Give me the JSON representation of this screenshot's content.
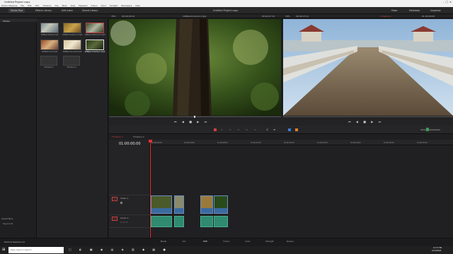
{
  "window": {
    "title": "Untitled Project copy"
  },
  "menu": [
    "DaVinci Resolve",
    "File",
    "Edit",
    "Trim",
    "Timeline",
    "Clip",
    "Mark",
    "View",
    "Playback",
    "Fusion",
    "Color",
    "Fairlight",
    "Workspace",
    "Help"
  ],
  "toolbar": {
    "media_pool": "Media Pool",
    "effects": "Effects Library",
    "edit_index": "Edit Index",
    "sound_library": "Sound Library",
    "project_title": "Untitled Project copy",
    "mixer": "Mixer",
    "metadata": "Metadata",
    "inspector": "Inspector"
  },
  "viewer_bar": {
    "zoom": "76%",
    "src_tc": "00:00:00:12",
    "clip_name": "1080p11medium.mp4",
    "dur": "00:02:27:13",
    "tl_zoom": "76%",
    "tl_tc": "00:00:15:11",
    "timeline_name": "Timeline 1",
    "tl_pos": "01:00:00:00"
  },
  "bins": {
    "master": "Master",
    "smart_bins": "Smart Bins",
    "keywords": "Keywords"
  },
  "media": [
    {
      "label": "1080p11trees.mp4"
    },
    {
      "label": "1080p11autumn.mp4"
    },
    {
      "label": "1080p11kitchen3.mp4"
    },
    {
      "label": "1080p11red.mp4"
    },
    {
      "label": "1080p11sunset.mp4"
    },
    {
      "label": "1080p11medium.mp4"
    },
    {
      "label": "Timeline 1"
    },
    {
      "label": "Timeline 2"
    }
  ],
  "timeline": {
    "tabs": [
      "Timeline 1",
      "Timeline 2"
    ],
    "timecode": "01:00:00:00",
    "ruler": [
      "01:00:00:00",
      "01:00:04:00",
      "01:00:08:00",
      "01:00:12:00",
      "01:00:16:00",
      "01:00:20:00",
      "01:00:24:00",
      "01:00:28:00",
      "01:00:32:00",
      "01:00:36:00"
    ],
    "video_track": {
      "id": "V1",
      "name": "Video 1"
    },
    "audio_track": {
      "id": "A1",
      "name": "Audio 1"
    }
  },
  "pages": [
    "Media",
    "Cut",
    "Edit",
    "Fusion",
    "Color",
    "Fairlight",
    "Deliver"
  ],
  "app_name": "DaVinci Resolve 16",
  "taskbar": {
    "search": "Type here to search",
    "time": "12:37 PM",
    "date": "2/14/2020"
  }
}
